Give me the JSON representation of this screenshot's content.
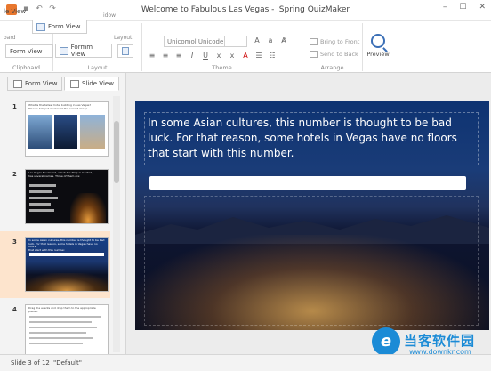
{
  "window": {
    "title": "Welcome to Fabulous Las Vegas - iSpring QuizMaker",
    "file_tab": "le View",
    "bg_tab": "idow"
  },
  "ribbon": {
    "ghost_tab_top": "Form View",
    "ghost_layout": "Layout",
    "ghost_clipboard_stub": "oard",
    "clipboard_label": "Clipboard",
    "layout_label": "Layout",
    "theme_label": "Theme",
    "arrange_label": "Arrange",
    "form_view_btn": "Form View",
    "formm_view_btn": "Formm View",
    "font_name": "Unicomol Unicode MS",
    "font_size": "",
    "bring_to_front": "Bring to Front",
    "send_to_back": "Send to Back",
    "preview_label": "Preview"
  },
  "left_panel": {
    "tabs": [
      {
        "label": "Form View"
      },
      {
        "label": "Slide View"
      }
    ],
    "thumbnails": [
      {
        "number": "1",
        "text": "What is the tallest hotel building in Las Vegas?\nPlace a hotspot marker at the correct image."
      },
      {
        "number": "2",
        "text": "Las Vegas Boulevard, which the Strip is located,\nhas several names. Three of them are:"
      },
      {
        "number": "3",
        "text": "In some Asian cultures, this number is thought to be bad\nluck. For that reason, some hotels in Vegas have no floors\nthat start with this number."
      },
      {
        "number": "4",
        "text": "Drag the events and drop them to the appropriate places."
      }
    ]
  },
  "slide": {
    "question": "In some Asian cultures, this number is thought to be bad luck. For that reason, some hotels in Vegas have no floors that start with this number."
  },
  "status": {
    "slide_counter": "Slide 3 of 12",
    "theme": "\"Default\""
  },
  "watermark": {
    "text": "当客软件园",
    "url": "www.downkr.com"
  },
  "colors": {
    "accent": "#e8772e",
    "selection": "#fde4cd",
    "preview": "#3b6fb6",
    "watermark": "#1b8bd6"
  }
}
